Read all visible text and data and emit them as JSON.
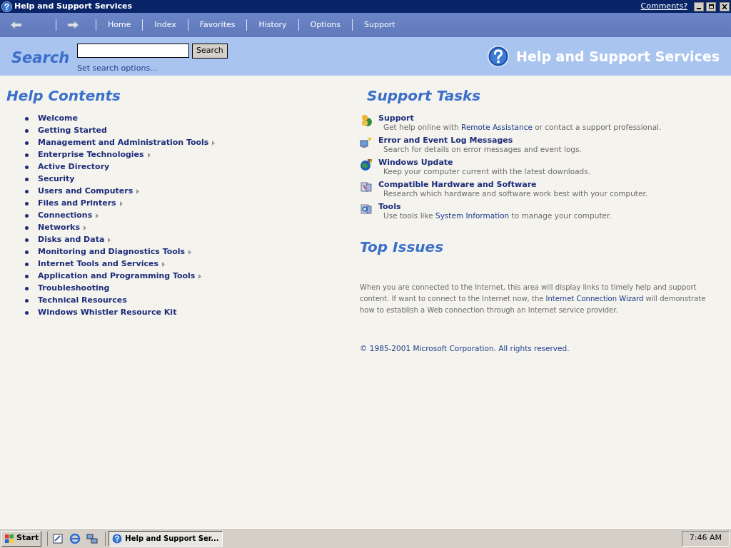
{
  "window": {
    "title": "Help and Support Services",
    "comments_link": "Comments?"
  },
  "nav": [
    "Home",
    "Index",
    "Favorites",
    "History",
    "Options",
    "Support"
  ],
  "search": {
    "heading": "Search",
    "button": "Search",
    "options_link": "Set search options...",
    "banner": "Help and Support Services"
  },
  "help_contents": {
    "heading": "Help Contents",
    "items": [
      {
        "label": "Welcome",
        "has_submenu": false
      },
      {
        "label": "Getting Started",
        "has_submenu": false
      },
      {
        "label": "Management and Administration Tools",
        "has_submenu": true
      },
      {
        "label": "Enterprise Technologies",
        "has_submenu": true
      },
      {
        "label": "Active Directory",
        "has_submenu": false
      },
      {
        "label": "Security",
        "has_submenu": false
      },
      {
        "label": "Users and Computers",
        "has_submenu": true
      },
      {
        "label": "Files and Printers",
        "has_submenu": true
      },
      {
        "label": "Connections",
        "has_submenu": true
      },
      {
        "label": "Networks",
        "has_submenu": true
      },
      {
        "label": "Disks and Data",
        "has_submenu": true
      },
      {
        "label": "Monitoring and Diagnostics Tools",
        "has_submenu": true
      },
      {
        "label": "Internet Tools and Services",
        "has_submenu": true
      },
      {
        "label": "Application and Programming Tools",
        "has_submenu": true
      },
      {
        "label": "Troubleshooting",
        "has_submenu": false
      },
      {
        "label": "Technical Resources",
        "has_submenu": false
      },
      {
        "label": "Windows Whistler Resource Kit",
        "has_submenu": false
      }
    ]
  },
  "support_tasks": {
    "heading": "Support Tasks",
    "items": [
      {
        "kind": "support",
        "title": "Support",
        "description": [
          {
            "text": "Get help online with ",
            "link": false
          },
          {
            "text": "Remote Assistance",
            "link": true
          },
          {
            "text": " or contact a support professional.",
            "link": false
          }
        ]
      },
      {
        "kind": "errors",
        "title": "Error and Event Log Messages",
        "description": [
          {
            "text": "Search for details on error messages and event logs.",
            "link": false
          }
        ]
      },
      {
        "kind": "update",
        "title": "Windows Update",
        "description": [
          {
            "text": "Keep your computer current with the latest downloads.",
            "link": false
          }
        ]
      },
      {
        "kind": "hardware",
        "title": "Compatible Hardware and Software",
        "description": [
          {
            "text": "Research which hardware and software work best with your computer.",
            "link": false
          }
        ]
      },
      {
        "kind": "tools",
        "title": "Tools",
        "description": [
          {
            "text": "Use tools like ",
            "link": false
          },
          {
            "text": "System Information",
            "link": true
          },
          {
            "text": " to manage your computer.",
            "link": false
          }
        ]
      }
    ]
  },
  "top_issues": {
    "heading": "Top Issues",
    "body": [
      {
        "text": "When you are connected to the Internet, this area will display links to timely help and support content. If want to connect to the Internet now, the ",
        "link": false
      },
      {
        "text": "Internet Connection Wizard",
        "link": true
      },
      {
        "text": " will demonstrate how to establish a Web connection through an Internet service provider.",
        "link": false
      }
    ],
    "copyright": "© 1985-2001 Microsoft Corporation. All rights reserved."
  },
  "taskbar": {
    "start": "Start",
    "task": "Help and Support Ser...",
    "clock": "7:46 AM"
  }
}
